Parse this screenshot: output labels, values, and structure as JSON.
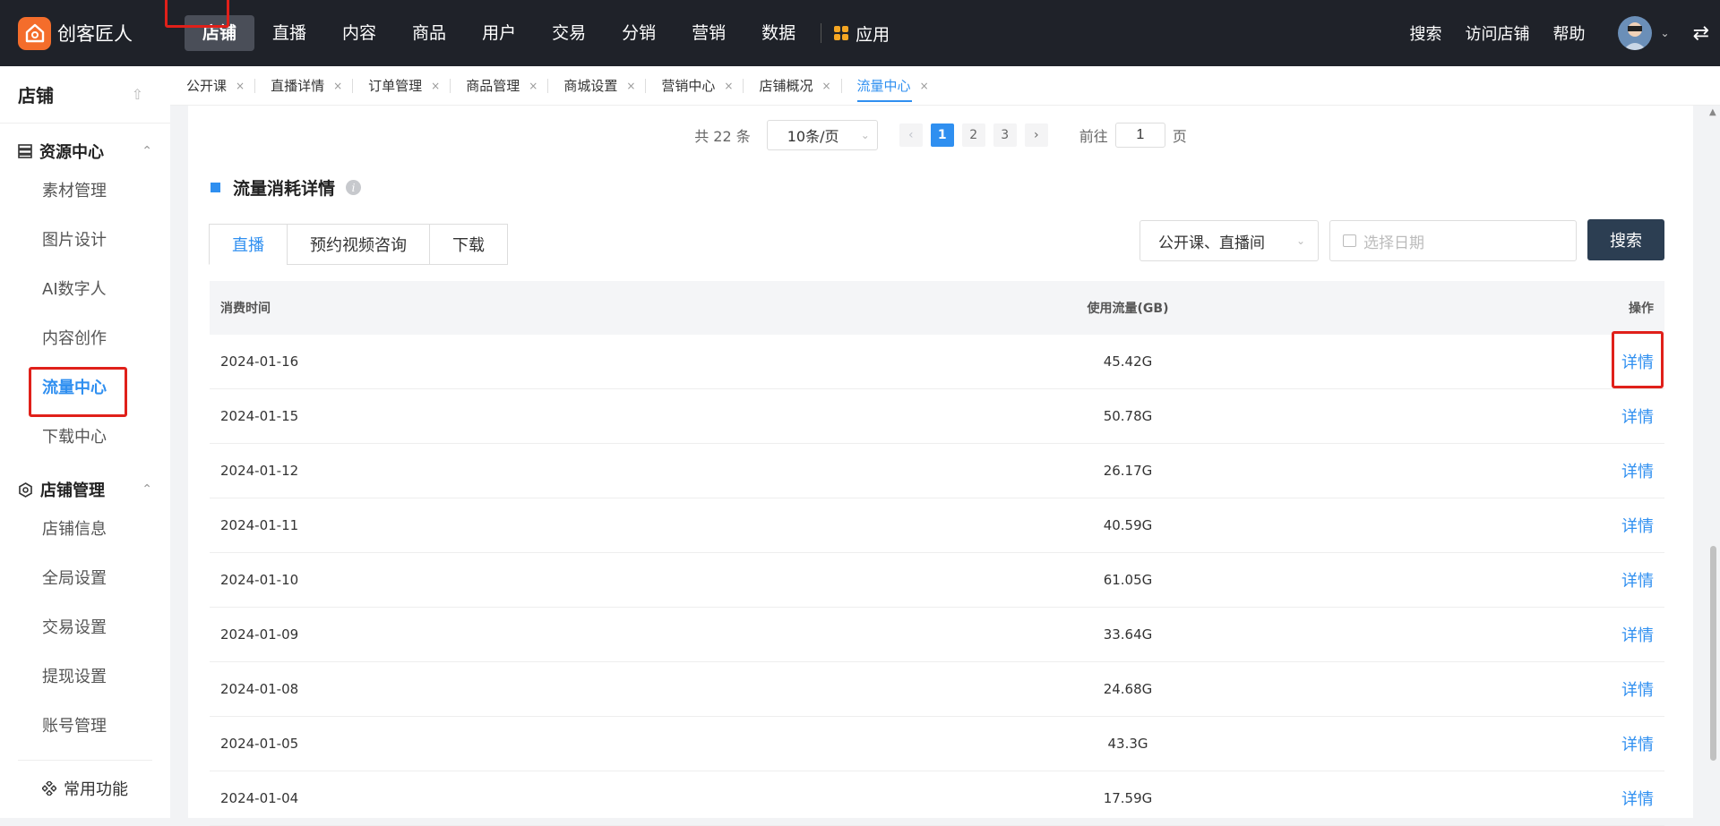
{
  "app": {
    "name": "创客匠人"
  },
  "topnav": {
    "items": [
      {
        "label": "店铺",
        "active": true
      },
      {
        "label": "直播"
      },
      {
        "label": "内容"
      },
      {
        "label": "商品"
      },
      {
        "label": "用户"
      },
      {
        "label": "交易"
      },
      {
        "label": "分销"
      },
      {
        "label": "营销"
      },
      {
        "label": "数据"
      }
    ],
    "apps_label": "应用",
    "right": {
      "search": "搜索",
      "visit_store": "访问店铺",
      "help": "帮助"
    }
  },
  "sidebar": {
    "title": "店铺",
    "groups": [
      {
        "label": "资源中心",
        "icon": "storage-icon",
        "items": [
          "素材管理",
          "图片设计",
          "AI数字人",
          "内容创作",
          "流量中心",
          "下载中心"
        ],
        "active": "流量中心"
      },
      {
        "label": "店铺管理",
        "icon": "settings-icon",
        "items": [
          "店铺信息",
          "全局设置",
          "交易设置",
          "提现设置",
          "账号管理"
        ]
      }
    ],
    "common": "常用功能"
  },
  "tabs": [
    {
      "label": "公开课"
    },
    {
      "label": "直播详情"
    },
    {
      "label": "订单管理"
    },
    {
      "label": "商品管理"
    },
    {
      "label": "商城设置"
    },
    {
      "label": "营销中心"
    },
    {
      "label": "店铺概况"
    },
    {
      "label": "流量中心",
      "active": true
    }
  ],
  "pager": {
    "total": "共 22 条",
    "page_size": "10条/页",
    "pages": [
      "1",
      "2",
      "3"
    ],
    "current": "1",
    "goto_prefix": "前往",
    "goto_value": "1",
    "goto_suffix": "页"
  },
  "section": {
    "title": "流量消耗详情",
    "info_icon": "i",
    "tabs": [
      "直播",
      "预约视频咨询",
      "下载"
    ],
    "active_tab": "直播",
    "filter_value": "公开课、直播间",
    "date_placeholder": "选择日期",
    "search_label": "搜索"
  },
  "table": {
    "headers": [
      "消费时间",
      "使用流量(GB)",
      "操作"
    ],
    "rows": [
      {
        "date": "2024-01-16",
        "traffic": "45.42G",
        "action": "详情"
      },
      {
        "date": "2024-01-15",
        "traffic": "50.78G",
        "action": "详情"
      },
      {
        "date": "2024-01-12",
        "traffic": "26.17G",
        "action": "详情"
      },
      {
        "date": "2024-01-11",
        "traffic": "40.59G",
        "action": "详情"
      },
      {
        "date": "2024-01-10",
        "traffic": "61.05G",
        "action": "详情"
      },
      {
        "date": "2024-01-09",
        "traffic": "33.64G",
        "action": "详情"
      },
      {
        "date": "2024-01-08",
        "traffic": "24.68G",
        "action": "详情"
      },
      {
        "date": "2024-01-05",
        "traffic": "43.3G",
        "action": "详情"
      },
      {
        "date": "2024-01-04",
        "traffic": "17.59G",
        "action": "详情"
      }
    ]
  },
  "colors": {
    "accent": "#2f8ff0",
    "topbar": "#1f2229",
    "highlight": "#e0201a",
    "brand": "#f46d2b"
  }
}
